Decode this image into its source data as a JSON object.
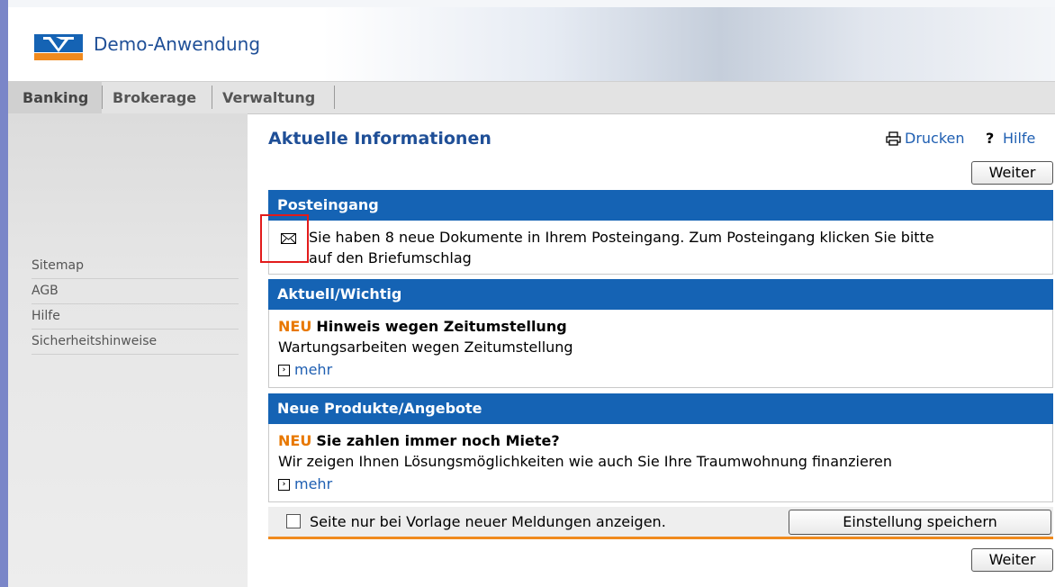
{
  "header": {
    "app_title": "Demo-Anwendung",
    "logo_icon": "vr-bank-logo"
  },
  "tabs": [
    {
      "label": "Banking",
      "active": true
    },
    {
      "label": "Brokerage",
      "active": false
    },
    {
      "label": "Verwaltung",
      "active": false
    }
  ],
  "sidebar": {
    "items": [
      "Sitemap",
      "AGB",
      "Hilfe",
      "Sicherheitshinweise"
    ]
  },
  "main": {
    "title": "Aktuelle Informationen",
    "print_label": "Drucken",
    "help_label": "Hilfe",
    "weiter_label": "Weiter",
    "sections": {
      "inbox": {
        "heading": "Posteingang",
        "line1": "Sie haben 8 neue Dokumente in Ihrem Posteingang. Zum Posteingang klicken Sie bitte",
        "line2": "auf den Briefumschlag"
      },
      "news": {
        "heading": "Aktuell/Wichtig",
        "badge": "NEU",
        "title": "Hinweis wegen Zeitumstellung",
        "text": "Wartungsarbeiten wegen Zeitumstellung",
        "more": "mehr"
      },
      "products": {
        "heading": "Neue Produkte/Angebote",
        "badge": "NEU",
        "title": "Sie zahlen immer noch Miete?",
        "text": "Wir zeigen Ihnen Lösungsmöglichkeiten wie auch Sie Ihre Traumwohnung finanzieren",
        "more": "mehr"
      }
    },
    "footer": {
      "checkbox_label": "Seite nur bei Vorlage neuer Meldungen anzeigen.",
      "checkbox_checked": false,
      "save_label": "Einstellung speichern"
    }
  },
  "colors": {
    "brand_blue": "#1563b4",
    "accent_orange": "#e87800",
    "link_blue": "#1f5fb2"
  }
}
